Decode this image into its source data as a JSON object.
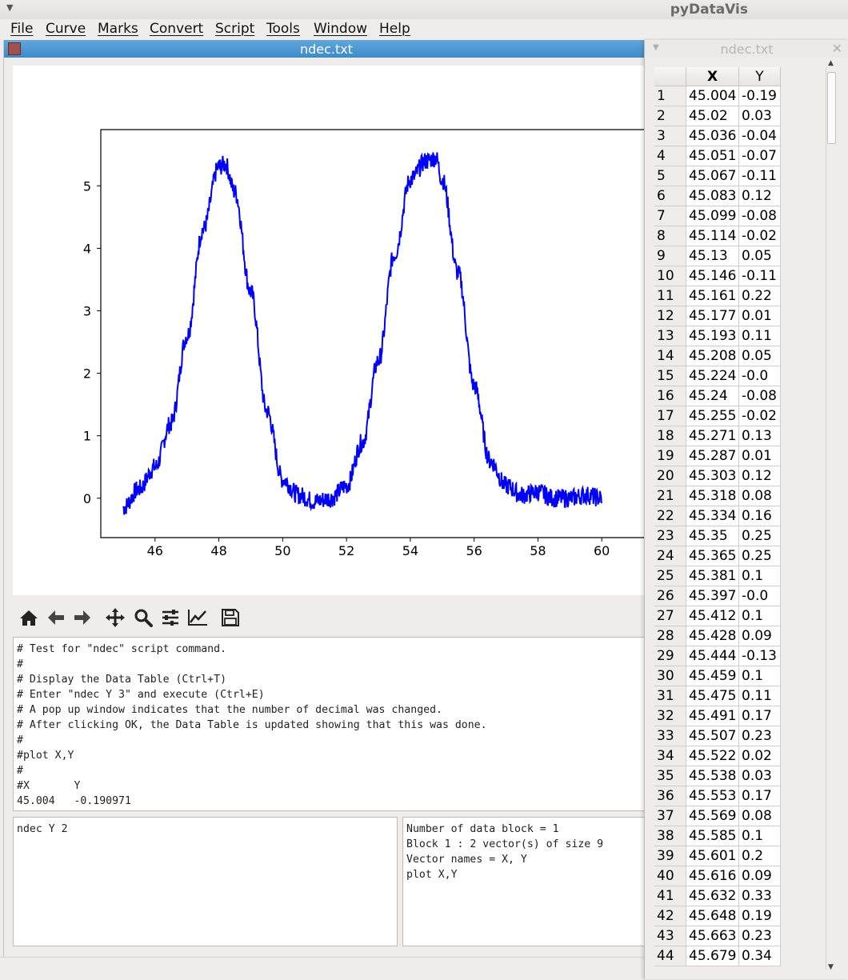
{
  "app_title": "pyDataVis",
  "menu": [
    "File",
    "Curve",
    "Marks",
    "Convert",
    "Script",
    "Tools",
    "Window",
    "Help"
  ],
  "plot_window": {
    "title": "ndec.txt"
  },
  "chart_data": {
    "type": "line",
    "title": "",
    "xlabel": "",
    "ylabel": "",
    "xlim": [
      44.3,
      61.6
    ],
    "ylim": [
      -0.63,
      5.9
    ],
    "xticks": [
      46,
      48,
      50,
      52,
      54,
      56,
      58,
      60
    ],
    "yticks": [
      0,
      1,
      2,
      3,
      4,
      5
    ],
    "color": "#0000ff",
    "series": [
      {
        "x": [
          45.0,
          45.5,
          46.0,
          46.5,
          47.0,
          47.5,
          48.0,
          48.2,
          48.5,
          49.0,
          49.5,
          50.0,
          50.5,
          51.0,
          51.5,
          52.0,
          52.5,
          53.0,
          53.5,
          54.0,
          54.5,
          54.8,
          55.0,
          55.5,
          56.0,
          56.5,
          57.0,
          57.5,
          58.0,
          58.5,
          59.0,
          59.5,
          60.0
        ],
        "y": [
          -0.15,
          0.15,
          0.5,
          1.2,
          2.6,
          4.3,
          5.3,
          5.35,
          4.9,
          3.3,
          1.4,
          0.3,
          0.05,
          -0.05,
          0.0,
          0.2,
          0.9,
          2.2,
          3.9,
          5.1,
          5.4,
          5.45,
          5.1,
          3.6,
          1.8,
          0.6,
          0.2,
          0.05,
          0.1,
          0.0,
          0.0,
          0.05,
          0.0
        ]
      }
    ]
  },
  "toolbar": {
    "buttons": [
      "home-icon",
      "back-arrow-icon",
      "forward-arrow-icon",
      "pan-icon",
      "zoom-icon",
      "subplots-config-icon",
      "axes-edit-icon",
      "save-icon"
    ]
  },
  "script_text": "# Test for \"ndec\" script command.\n#\n# Display the Data Table (Ctrl+T)\n# Enter \"ndec Y 3\" and execute (Ctrl+E)\n# A pop up window indicates that the number of decimal was changed.\n# After clicking OK, the Data Table is updated showing that this was done.\n#\n#plot X,Y\n#\n#X       Y\n45.004   -0.190971",
  "command_text": "ndec Y 2",
  "info_text": "Number of data block = 1\nBlock 1 : 2 vector(s) of size 9\nVector names = X, Y\nplot X,Y",
  "table_window": {
    "title": "ndec.txt",
    "headers": [
      "X",
      "Y"
    ],
    "rows": [
      [
        "1",
        "45.004",
        "-0.19"
      ],
      [
        "2",
        "45.02",
        "0.03"
      ],
      [
        "3",
        "45.036",
        "-0.04"
      ],
      [
        "4",
        "45.051",
        "-0.07"
      ],
      [
        "5",
        "45.067",
        "-0.11"
      ],
      [
        "6",
        "45.083",
        "0.12"
      ],
      [
        "7",
        "45.099",
        "-0.08"
      ],
      [
        "8",
        "45.114",
        "-0.02"
      ],
      [
        "9",
        "45.13",
        "0.05"
      ],
      [
        "10",
        "45.146",
        "-0.11"
      ],
      [
        "11",
        "45.161",
        "0.22"
      ],
      [
        "12",
        "45.177",
        "0.01"
      ],
      [
        "13",
        "45.193",
        "0.11"
      ],
      [
        "14",
        "45.208",
        "0.05"
      ],
      [
        "15",
        "45.224",
        "-0.0"
      ],
      [
        "16",
        "45.24",
        "-0.08"
      ],
      [
        "17",
        "45.255",
        "-0.02"
      ],
      [
        "18",
        "45.271",
        "0.13"
      ],
      [
        "19",
        "45.287",
        "0.01"
      ],
      [
        "20",
        "45.303",
        "0.12"
      ],
      [
        "21",
        "45.318",
        "0.08"
      ],
      [
        "22",
        "45.334",
        "0.16"
      ],
      [
        "23",
        "45.35",
        "0.25"
      ],
      [
        "24",
        "45.365",
        "0.25"
      ],
      [
        "25",
        "45.381",
        "0.1"
      ],
      [
        "26",
        "45.397",
        "-0.0"
      ],
      [
        "27",
        "45.412",
        "0.1"
      ],
      [
        "28",
        "45.428",
        "0.09"
      ],
      [
        "29",
        "45.444",
        "-0.13"
      ],
      [
        "30",
        "45.459",
        "0.1"
      ],
      [
        "31",
        "45.475",
        "0.11"
      ],
      [
        "32",
        "45.491",
        "0.17"
      ],
      [
        "33",
        "45.507",
        "0.23"
      ],
      [
        "34",
        "45.522",
        "0.02"
      ],
      [
        "35",
        "45.538",
        "0.03"
      ],
      [
        "36",
        "45.553",
        "0.17"
      ],
      [
        "37",
        "45.569",
        "0.08"
      ],
      [
        "38",
        "45.585",
        "0.1"
      ],
      [
        "39",
        "45.601",
        "0.2"
      ],
      [
        "40",
        "45.616",
        "0.09"
      ],
      [
        "41",
        "45.632",
        "0.33"
      ],
      [
        "42",
        "45.648",
        "0.19"
      ],
      [
        "43",
        "45.663",
        "0.23"
      ],
      [
        "44",
        "45.679",
        "0.34"
      ]
    ]
  }
}
